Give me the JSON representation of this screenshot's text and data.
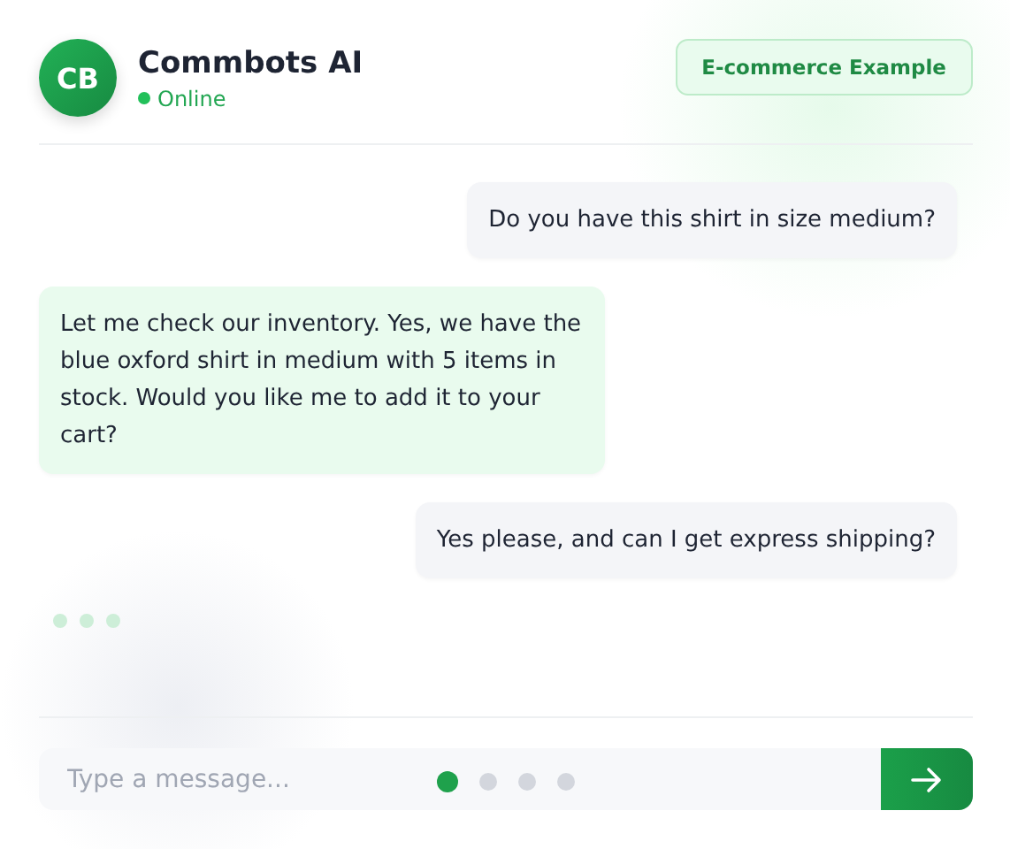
{
  "header": {
    "avatar": "CB",
    "name": "Commbots AI",
    "status": "Online",
    "badge": "E-commerce Example"
  },
  "messages": [
    {
      "kind": "user",
      "text": "Do you have this shirt in size medium?"
    },
    {
      "kind": "bot",
      "text": "Let me check our inventory. Yes, we have the blue oxford shirt in medium with 5 items in stock. Would you like me to add it to your cart?"
    },
    {
      "kind": "user",
      "text": "Yes please, and can I get express shipping?"
    }
  ],
  "typing": true,
  "composer": {
    "placeholder": "Type a message..."
  },
  "pager": [
    {
      "selected": true
    },
    {
      "selected": false
    },
    {
      "selected": false
    },
    {
      "selected": false
    }
  ]
}
